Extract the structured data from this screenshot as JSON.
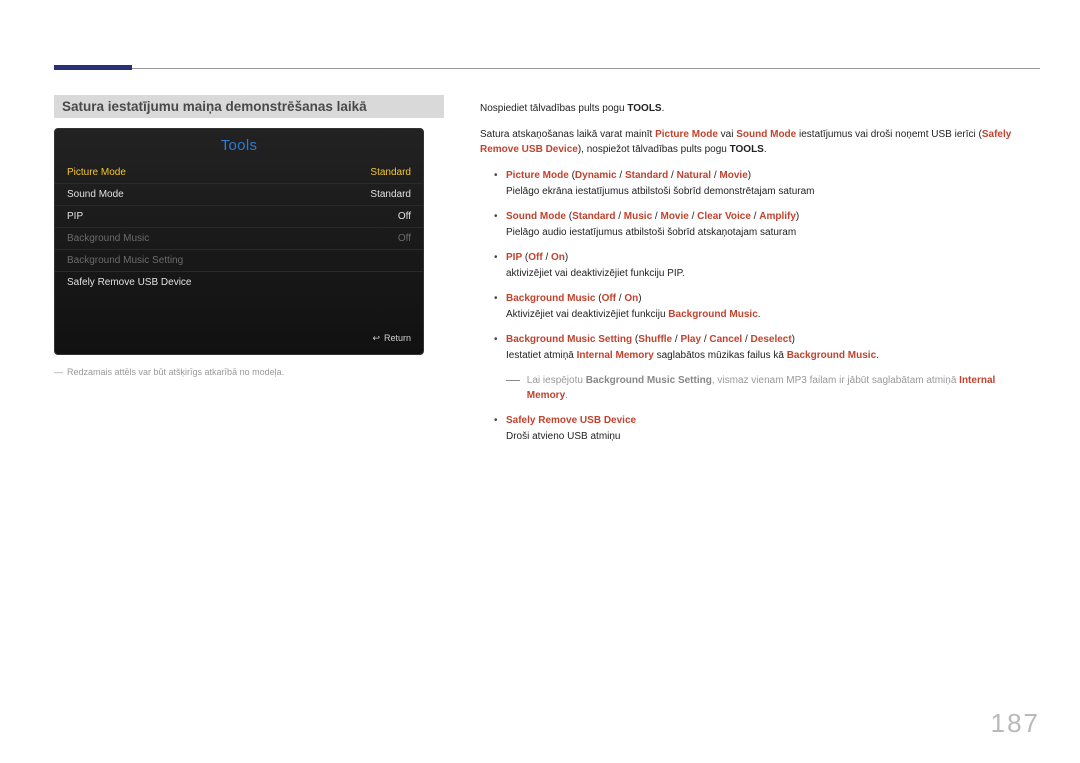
{
  "page_number": "187",
  "section_title": "Satura iestatījumu maiņa demonstrēšanas laikā",
  "tv": {
    "title": "Tools",
    "rows": [
      {
        "label": "Picture Mode",
        "value": "Standard",
        "style": "highlight"
      },
      {
        "label": "Sound Mode",
        "value": "Standard",
        "style": ""
      },
      {
        "label": "PIP",
        "value": "Off",
        "style": ""
      },
      {
        "label": "Background Music",
        "value": "Off",
        "style": "dim"
      },
      {
        "label": "Background Music Setting",
        "value": "",
        "style": "dim"
      },
      {
        "label": "Safely Remove USB Device",
        "value": "",
        "style": ""
      }
    ],
    "return_label": "Return",
    "return_icon": "↩"
  },
  "caption_dash": "―",
  "caption_text": "Redzamais attēls var būt atšķirīgs atkarībā no modeļa.",
  "intro": {
    "t1a": "Nospiediet tālvadības pults pogu ",
    "t1b": "TOOLS",
    "t1c": ".",
    "t2a": "Satura atskaņošanas laikā varat mainīt ",
    "t2b": "Picture Mode",
    "t2c": " vai ",
    "t2d": "Sound Mode",
    "t2e": " iestatījumus vai droši noņemt USB ierīci (",
    "t2f": "Safely Remove USB Device",
    "t2g": "), nospiežot tālvadības pults pogu ",
    "t2h": "TOOLS",
    "t2i": "."
  },
  "items": [
    {
      "head_parts": [
        "Picture Mode",
        " (",
        "Dynamic",
        " / ",
        "Standard",
        " / ",
        "Natural",
        " / ",
        "Movie",
        ")"
      ],
      "sub": "Pielāgo ekrāna iestatījumus atbilstoši šobrīd demonstrētajam saturam"
    },
    {
      "head_parts": [
        "Sound Mode",
        " (",
        "Standard",
        " / ",
        "Music",
        " / ",
        "Movie",
        " / ",
        "Clear Voice",
        " / ",
        "Amplify",
        ")"
      ],
      "sub": "Pielāgo audio iestatījumus atbilstoši šobrīd atskaņotajam saturam"
    },
    {
      "head_parts": [
        "PIP",
        " (",
        "Off",
        " / ",
        "On",
        ")"
      ],
      "sub": "aktivizējiet vai deaktivizējiet funkciju PIP."
    },
    {
      "head_parts": [
        "Background Music",
        " (",
        "Off",
        " / ",
        "On",
        ")"
      ],
      "sub_parts": [
        "Aktivizējiet vai deaktivizējiet funkciju ",
        "Background Music",
        "."
      ]
    },
    {
      "head_parts": [
        "Background Music Setting",
        " (",
        "Shuffle",
        " / ",
        "Play",
        " / ",
        "Cancel",
        " / ",
        "Deselect",
        ")"
      ],
      "sub_parts": [
        "Iestatiet atmiņā ",
        "Internal Memory",
        " saglabātos mūzikas failus kā ",
        "Background Music",
        "."
      ]
    }
  ],
  "note": {
    "a": "Lai iespējotu ",
    "b": "Background Music Setting",
    "c": ", vismaz vienam MP3 failam ir jābūt saglabātam atmiņā ",
    "d": "Internal Memory",
    "e": "."
  },
  "last_item": {
    "head": "Safely Remove USB Device",
    "sub": "Droši atvieno USB atmiņu"
  }
}
